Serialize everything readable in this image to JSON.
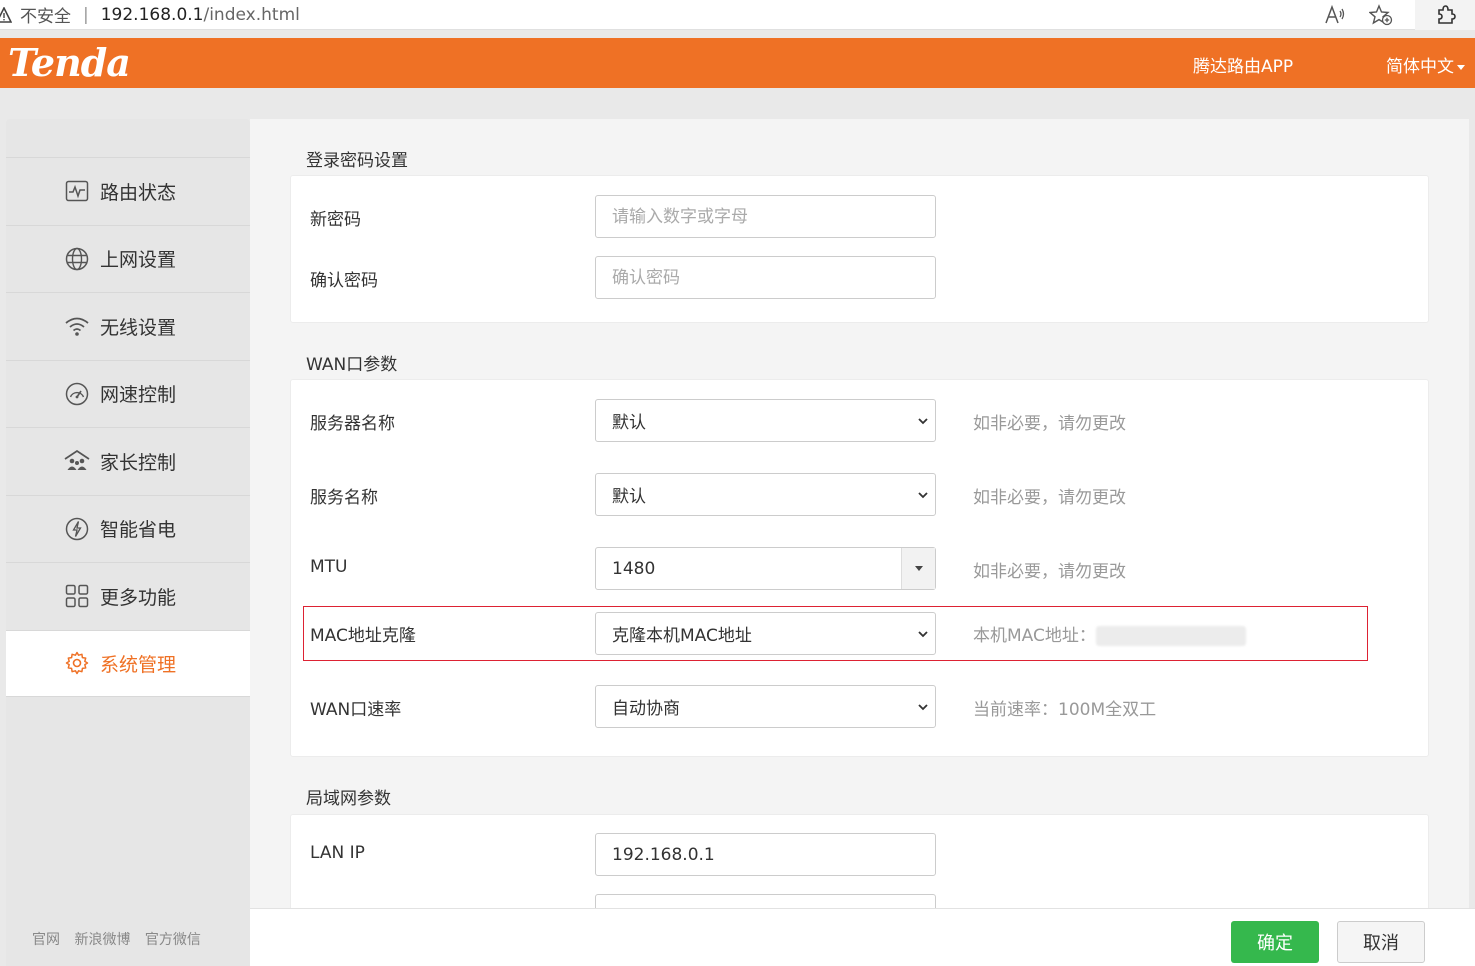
{
  "browser": {
    "insecure_label": "不安全",
    "separator": "|",
    "url_host": "192.168.0.1",
    "url_path": "/index.html"
  },
  "header": {
    "logo": "Tenda",
    "app_link": "腾达路由APP",
    "language": "简体中文"
  },
  "sidebar": {
    "items": [
      {
        "label": "路由状态",
        "icon": "pulse-icon"
      },
      {
        "label": "上网设置",
        "icon": "globe-icon"
      },
      {
        "label": "无线设置",
        "icon": "wifi-icon"
      },
      {
        "label": "网速控制",
        "icon": "speedometer-icon"
      },
      {
        "label": "家长控制",
        "icon": "family-icon"
      },
      {
        "label": "智能省电",
        "icon": "power-save-icon"
      },
      {
        "label": "更多功能",
        "icon": "grid-icon"
      },
      {
        "label": "系统管理",
        "icon": "gear-icon",
        "active": true
      }
    ],
    "footer_links": [
      "官网",
      "新浪微博",
      "官方微信"
    ]
  },
  "login_password": {
    "title": "登录密码设置",
    "new_password_label": "新密码",
    "new_password_placeholder": "请输入数字或字母",
    "confirm_password_label": "确认密码",
    "confirm_password_placeholder": "确认密码"
  },
  "wan": {
    "title": "WAN口参数",
    "server_name_label": "服务器名称",
    "server_name_value": "默认",
    "server_name_hint": "如非必要，请勿更改",
    "service_name_label": "服务名称",
    "service_name_value": "默认",
    "service_name_hint": "如非必要，请勿更改",
    "mtu_label": "MTU",
    "mtu_value": "1480",
    "mtu_hint": "如非必要，请勿更改",
    "mac_clone_label": "MAC地址克隆",
    "mac_clone_value": "克隆本机MAC地址",
    "mac_hint": "本机MAC地址：",
    "wan_speed_label": "WAN口速率",
    "wan_speed_value": "自动协商",
    "wan_speed_hint": "当前速率：100M全双工"
  },
  "lan": {
    "title": "局域网参数",
    "lan_ip_label": "LAN IP",
    "lan_ip_value": "192.168.0.1"
  },
  "actions": {
    "ok": "确定",
    "cancel": "取消"
  },
  "colors": {
    "brand": "#ef7125",
    "ok_button": "#35b84d",
    "highlight_border": "#dd2233"
  }
}
